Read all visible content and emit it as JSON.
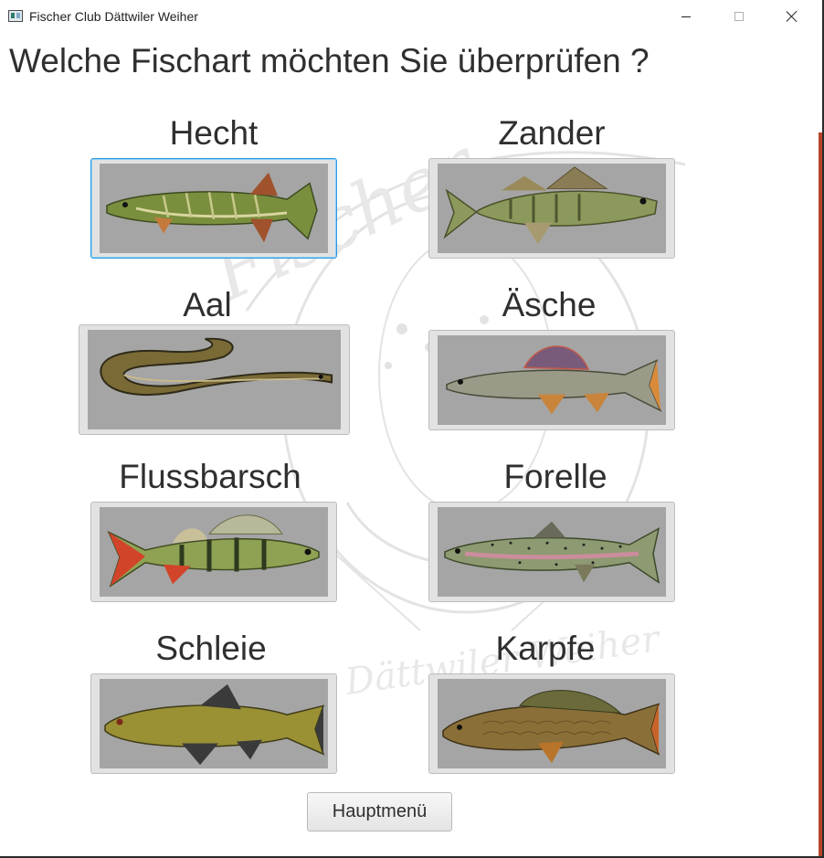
{
  "window": {
    "title": "Fischer Club Dättwiler Weiher",
    "app_icon": "app-window-icon",
    "controls": [
      "minimize-icon",
      "maximize-icon",
      "close-icon"
    ]
  },
  "heading": "Welche Fischart möchten Sie überprüfen ?",
  "fish": [
    {
      "label": "Hecht",
      "image": "pike"
    },
    {
      "label": "Zander",
      "image": "zander"
    },
    {
      "label": "Aal",
      "image": "eel"
    },
    {
      "label": "Äsche",
      "image": "grayling"
    },
    {
      "label": "Flussbarsch",
      "image": "perch"
    },
    {
      "label": "Forelle",
      "image": "trout"
    },
    {
      "label": "Schleie",
      "image": "tench"
    },
    {
      "label": "Karpfe",
      "image": "carp"
    }
  ],
  "main_menu_button": "Hauptmenü",
  "watermark_text": {
    "top": "Fischer",
    "bottom": "Dättwiler Weiher"
  },
  "colors": {
    "image_background": "#a5a5a5",
    "focus_border": "#2a9be0",
    "edge_accent": "#b8452a",
    "text": "#2f2f2f"
  }
}
